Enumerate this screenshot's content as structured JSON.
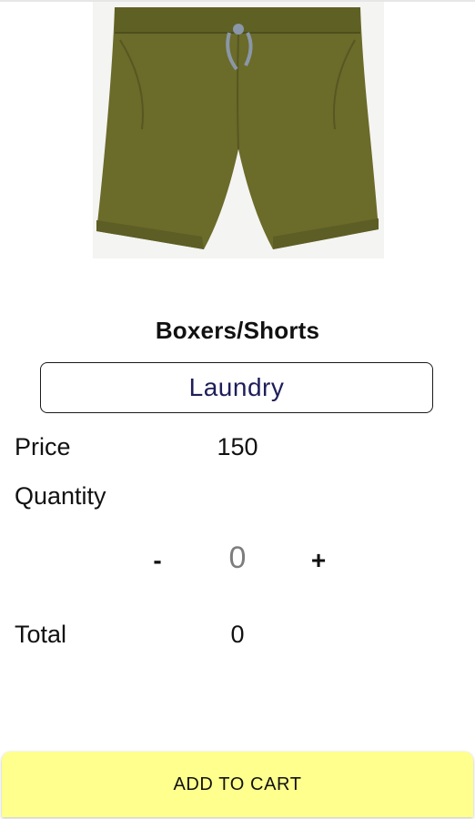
{
  "product": {
    "image_alt": "olive-green-drawstring-shorts",
    "title": "Boxers/Shorts",
    "category": "Laundry"
  },
  "price": {
    "label": "Price",
    "value": "150"
  },
  "quantity": {
    "label": "Quantity",
    "decrement": "-",
    "value": "0",
    "increment": "+"
  },
  "total": {
    "label": "Total",
    "value": "0"
  },
  "cta": {
    "label": "ADD TO CART"
  },
  "colors": {
    "product": "#6b6b2a",
    "cta_background": "#ffff8d",
    "category_text": "#1e1e5a",
    "stepper_value": "#7d7d7d"
  }
}
